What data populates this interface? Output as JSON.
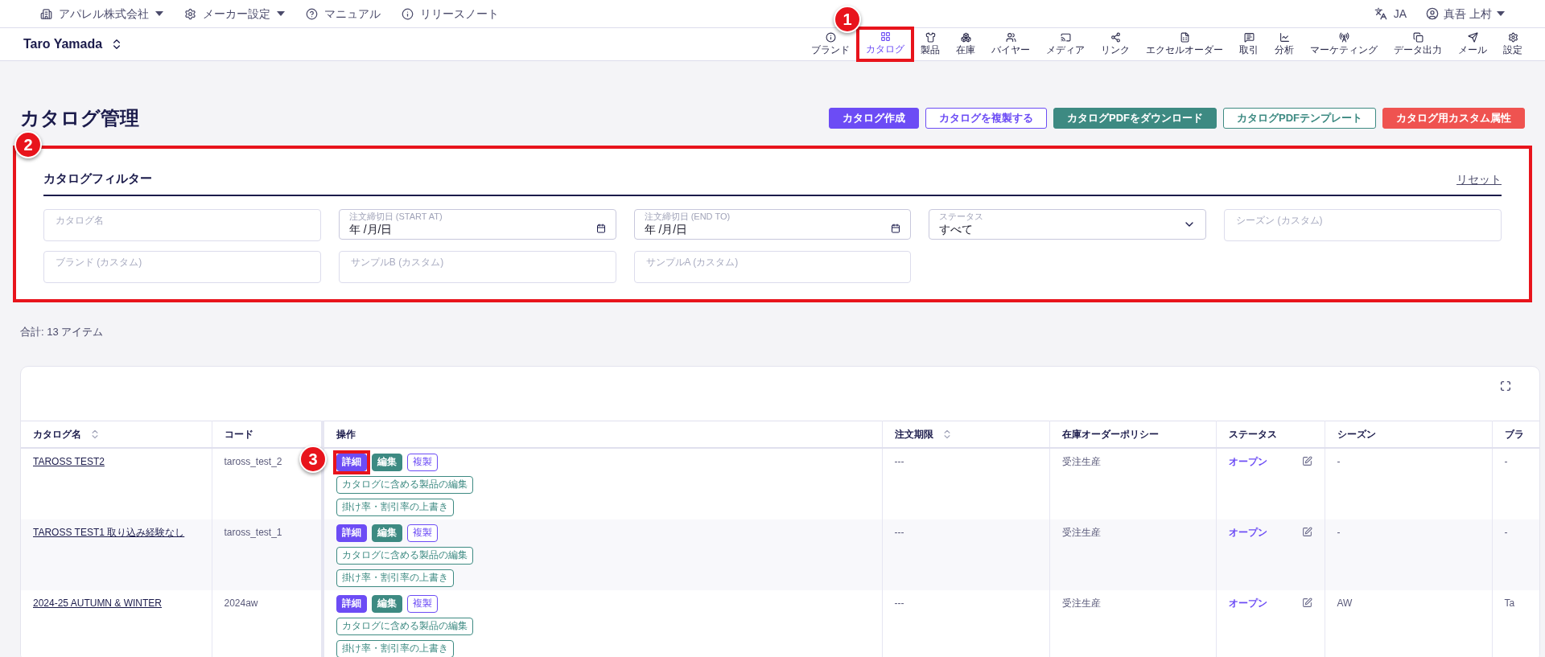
{
  "top_bar": {
    "items": [
      {
        "label": "アパレル株式会社",
        "kind": "dropdown"
      },
      {
        "label": "メーカー設定",
        "kind": "dropdown"
      },
      {
        "label": "マニュアル",
        "kind": "link"
      },
      {
        "label": "リリースノート",
        "kind": "link"
      }
    ],
    "language": "JA",
    "user": "真吾 上村"
  },
  "nav": {
    "account": "Taro Yamada",
    "items": [
      {
        "label": "ブランド",
        "selected": false
      },
      {
        "label": "カタログ",
        "selected": true,
        "annotation": "1"
      },
      {
        "label": "製品",
        "selected": false
      },
      {
        "label": "在庫",
        "selected": false
      },
      {
        "label": "バイヤー",
        "selected": false
      },
      {
        "label": "メディア",
        "selected": false
      },
      {
        "label": "リンク",
        "selected": false
      },
      {
        "label": "エクセルオーダー",
        "selected": false
      },
      {
        "label": "取引",
        "selected": false
      },
      {
        "label": "分析",
        "selected": false
      },
      {
        "label": "マーケティング",
        "selected": false
      },
      {
        "label": "データ出力",
        "selected": false
      },
      {
        "label": "メール",
        "selected": false
      },
      {
        "label": "設定",
        "selected": false
      }
    ]
  },
  "page": {
    "title": "カタログ管理",
    "actions": [
      {
        "label": "カタログ作成",
        "kind": "primary"
      },
      {
        "label": "カタログを複製する",
        "kind": "outline-primary"
      },
      {
        "label": "カタログPDFをダウンロード",
        "kind": "teal"
      },
      {
        "label": "カタログPDFテンプレート",
        "kind": "outline-teal"
      },
      {
        "label": "カタログ用カスタム属性",
        "kind": "danger"
      }
    ]
  },
  "filter": {
    "title": "カタログフィルター",
    "reset": "リセット",
    "annotation": "2",
    "fields": [
      {
        "kind": "text",
        "placeholder": "カタログ名"
      },
      {
        "kind": "date",
        "label": "注文締切日 (START AT)",
        "value": "年 /月/日"
      },
      {
        "kind": "date",
        "label": "注文締切日 (END TO)",
        "value": "年 /月/日"
      },
      {
        "kind": "select",
        "label": "ステータス",
        "value": "すべて"
      },
      {
        "kind": "text",
        "placeholder": "シーズン (カスタム)"
      },
      {
        "kind": "text",
        "placeholder": "ブランド (カスタム)"
      },
      {
        "kind": "text",
        "placeholder": "サンプルB (カスタム)"
      },
      {
        "kind": "text",
        "placeholder": "サンプルA (カスタム)"
      }
    ]
  },
  "total": "合計:  13 アイテム",
  "table": {
    "columns": [
      {
        "label": "カタログ名",
        "sortable": true
      },
      {
        "label": "コード",
        "sortable": false
      },
      {
        "label": "操作",
        "sortable": false
      },
      {
        "label": "注文期限",
        "sortable": true
      },
      {
        "label": "在庫オーダーポリシー",
        "sortable": false
      },
      {
        "label": "ステータス",
        "sortable": false
      },
      {
        "label": "シーズン",
        "sortable": false
      },
      {
        "label": "ブラ",
        "sortable": false
      }
    ],
    "rows": [
      {
        "name": "TAROSS TEST2",
        "code": "taross_test_2",
        "actions": [
          {
            "label": "詳細",
            "kind": "primary",
            "annotation": "3"
          },
          {
            "label": "編集",
            "kind": "teal"
          },
          {
            "label": "複製",
            "kind": "outline-primary"
          },
          {
            "label": "カタログに含める製品の編集",
            "kind": "outline-teal"
          },
          {
            "label": "掛け率・割引率の上書き",
            "kind": "outline-teal"
          }
        ],
        "deadline": "---",
        "policy": "受注生産",
        "status": "オープン",
        "season": "-",
        "column_8": "-"
      },
      {
        "name": "TAROSS TEST1 取り込み経験なし",
        "code": "taross_test_1",
        "actions": [
          {
            "label": "詳細",
            "kind": "primary"
          },
          {
            "label": "編集",
            "kind": "teal"
          },
          {
            "label": "複製",
            "kind": "outline-primary"
          },
          {
            "label": "カタログに含める製品の編集",
            "kind": "outline-teal"
          },
          {
            "label": "掛け率・割引率の上書き",
            "kind": "outline-teal"
          }
        ],
        "deadline": "---",
        "policy": "受注生産",
        "status": "オープン",
        "season": "-",
        "column_8": "-"
      },
      {
        "name": "2024-25 AUTUMN & WINTER",
        "code": "2024aw",
        "actions": [
          {
            "label": "詳細",
            "kind": "primary"
          },
          {
            "label": "編集",
            "kind": "teal"
          },
          {
            "label": "複製",
            "kind": "outline-primary"
          },
          {
            "label": "カタログに含める製品の編集",
            "kind": "outline-teal"
          },
          {
            "label": "掛け率・割引率の上書き",
            "kind": "outline-teal"
          }
        ],
        "deadline": "---",
        "policy": "受注生産",
        "status": "オープン",
        "season": "AW",
        "column_8": "Ta"
      }
    ]
  }
}
